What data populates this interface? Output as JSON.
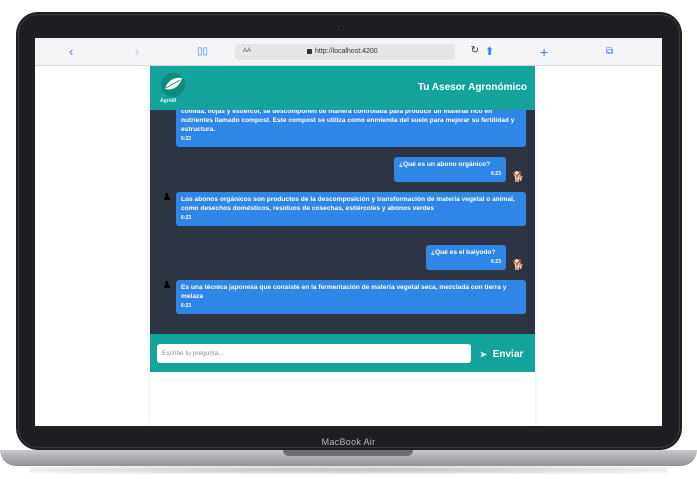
{
  "browser": {
    "address": "http://localhost:4200",
    "text_size": "AA"
  },
  "app": {
    "logo_text": "AgroIA",
    "title": "Tu Asesor Agronómico"
  },
  "messages": [
    {
      "role": "bot",
      "text": "comida, hojas y estiércol, se descomponen de manera controlada para producir un material rico en nutrientes llamado compost. Este compost se utiliza como enmienda del suelo para mejorar su fertilidad y estructura.",
      "time": "6:22"
    },
    {
      "role": "user",
      "text": "¿Qué es un abono orgánico?",
      "time": "6:23"
    },
    {
      "role": "bot",
      "text": "Los abonos orgánicos son productos de la descomposición y transformación de materia vegetal o animal, como desechos domésticos, residuos de cosechas, estiércoles y abonos verdes",
      "time": "6:23"
    },
    {
      "role": "user",
      "text": "¿Qué es el baiyodo?",
      "time": "6:23"
    },
    {
      "role": "bot",
      "text": "Es una técnica japonesa que consiste en la fermentación de materia vegetal seca, mezclada con tierra y melaza",
      "time": "6:23"
    }
  ],
  "input": {
    "placeholder": "Escribe tu pregunta...",
    "send_label": "Enviar"
  },
  "laptop": {
    "brand": "MacBook Air"
  }
}
